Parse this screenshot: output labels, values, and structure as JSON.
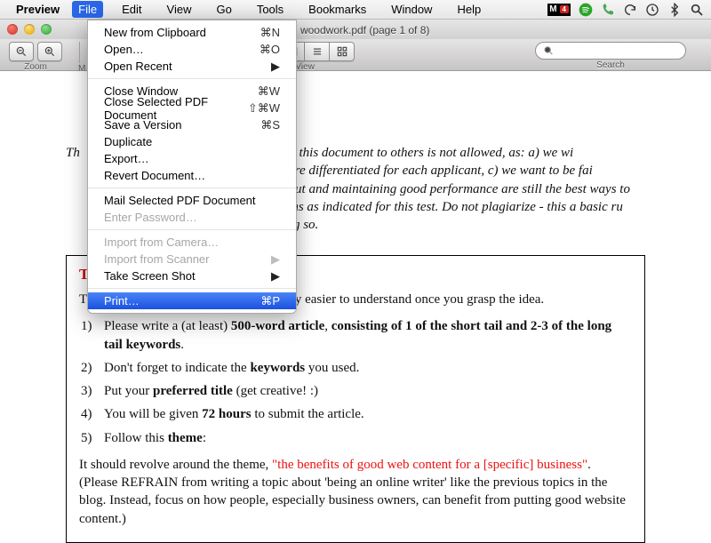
{
  "menubar": {
    "app": "Preview",
    "items": [
      "File",
      "Edit",
      "View",
      "Go",
      "Tools",
      "Bookmarks",
      "Window",
      "Help"
    ],
    "open_index": 0,
    "status": {
      "adobe_text": "M",
      "adobe_badge": "4"
    }
  },
  "window": {
    "title": "woodwork.pdf (page 1 of 8)"
  },
  "toolbar": {
    "zoom_label": "Zoom",
    "move_label": "M",
    "view_label": "View",
    "search_label": "Search",
    "search_placeholder": ""
  },
  "file_menu": [
    {
      "label": "New from Clipboard",
      "sc": "⌘N"
    },
    {
      "label": "Open…",
      "sc": "⌘O"
    },
    {
      "label": "Open Recent",
      "sub": true
    },
    {
      "sep": true
    },
    {
      "label": "Close Window",
      "sc": "⌘W"
    },
    {
      "label": "Close Selected PDF Document",
      "sc": "⇧⌘W"
    },
    {
      "label": "Save a Version",
      "sc": "⌘S"
    },
    {
      "label": "Duplicate"
    },
    {
      "label": "Export…"
    },
    {
      "label": "Revert Document…"
    },
    {
      "sep": true
    },
    {
      "label": "Mail Selected PDF Document"
    },
    {
      "label": "Enter Password…",
      "disabled": true
    },
    {
      "sep": true
    },
    {
      "label": "Import from Camera…",
      "disabled": true
    },
    {
      "label": "Import from Scanner",
      "sub": true,
      "disabled": true
    },
    {
      "label": "Take Screen Shot",
      "sub": true
    },
    {
      "sep": true
    },
    {
      "label": "Print…",
      "sc": "⌘P",
      "selected": true
    }
  ],
  "doc": {
    "intro_lead": "Th",
    "intro_rest": " woodwork applicants only. Sharing this document to others is not allowed, as: a) we wi",
    "intro_line2": " tests given are differentiated for each applicant, c) we want to be fai",
    "intro_line3": " ty output and maintaining good performance are still the best ways to",
    "intro_line4": " instructions as indicated for this test. Do not plagiarize - this a basic ru",
    "intro_line5": " oing so.",
    "heading": "T",
    "p1": "The instruction's pretty long but it's really easier to understand once you grasp the idea.",
    "li1_a": "Please write a (at least) ",
    "li1_b": "500-word article",
    "li1_c": ", ",
    "li1_d": "consisting of 1 of the short tail and 2-3 of the long tail keywords",
    "li1_e": ".",
    "li2_a": "Don't forget to indicate the ",
    "li2_b": "keywords",
    "li2_c": " you used.",
    "li3_a": "Put your ",
    "li3_b": "preferred title",
    "li3_c": " (get creative! :)",
    "li4_a": "You will be given ",
    "li4_b": "72 hours",
    "li4_c": " to submit the article.",
    "li5_a": "Follow this ",
    "li5_b": "theme",
    "li5_c": ":",
    "closing_a": "It should revolve around the theme, ",
    "closing_hand": "\"the benefits of good web content for a [specific] business\"",
    "closing_b": ". (Please REFRAIN from writing a topic about 'being an online writer' like the previous topics in the blog. Instead, focus on how people, especially business owners, can benefit from putting good website content.)"
  }
}
